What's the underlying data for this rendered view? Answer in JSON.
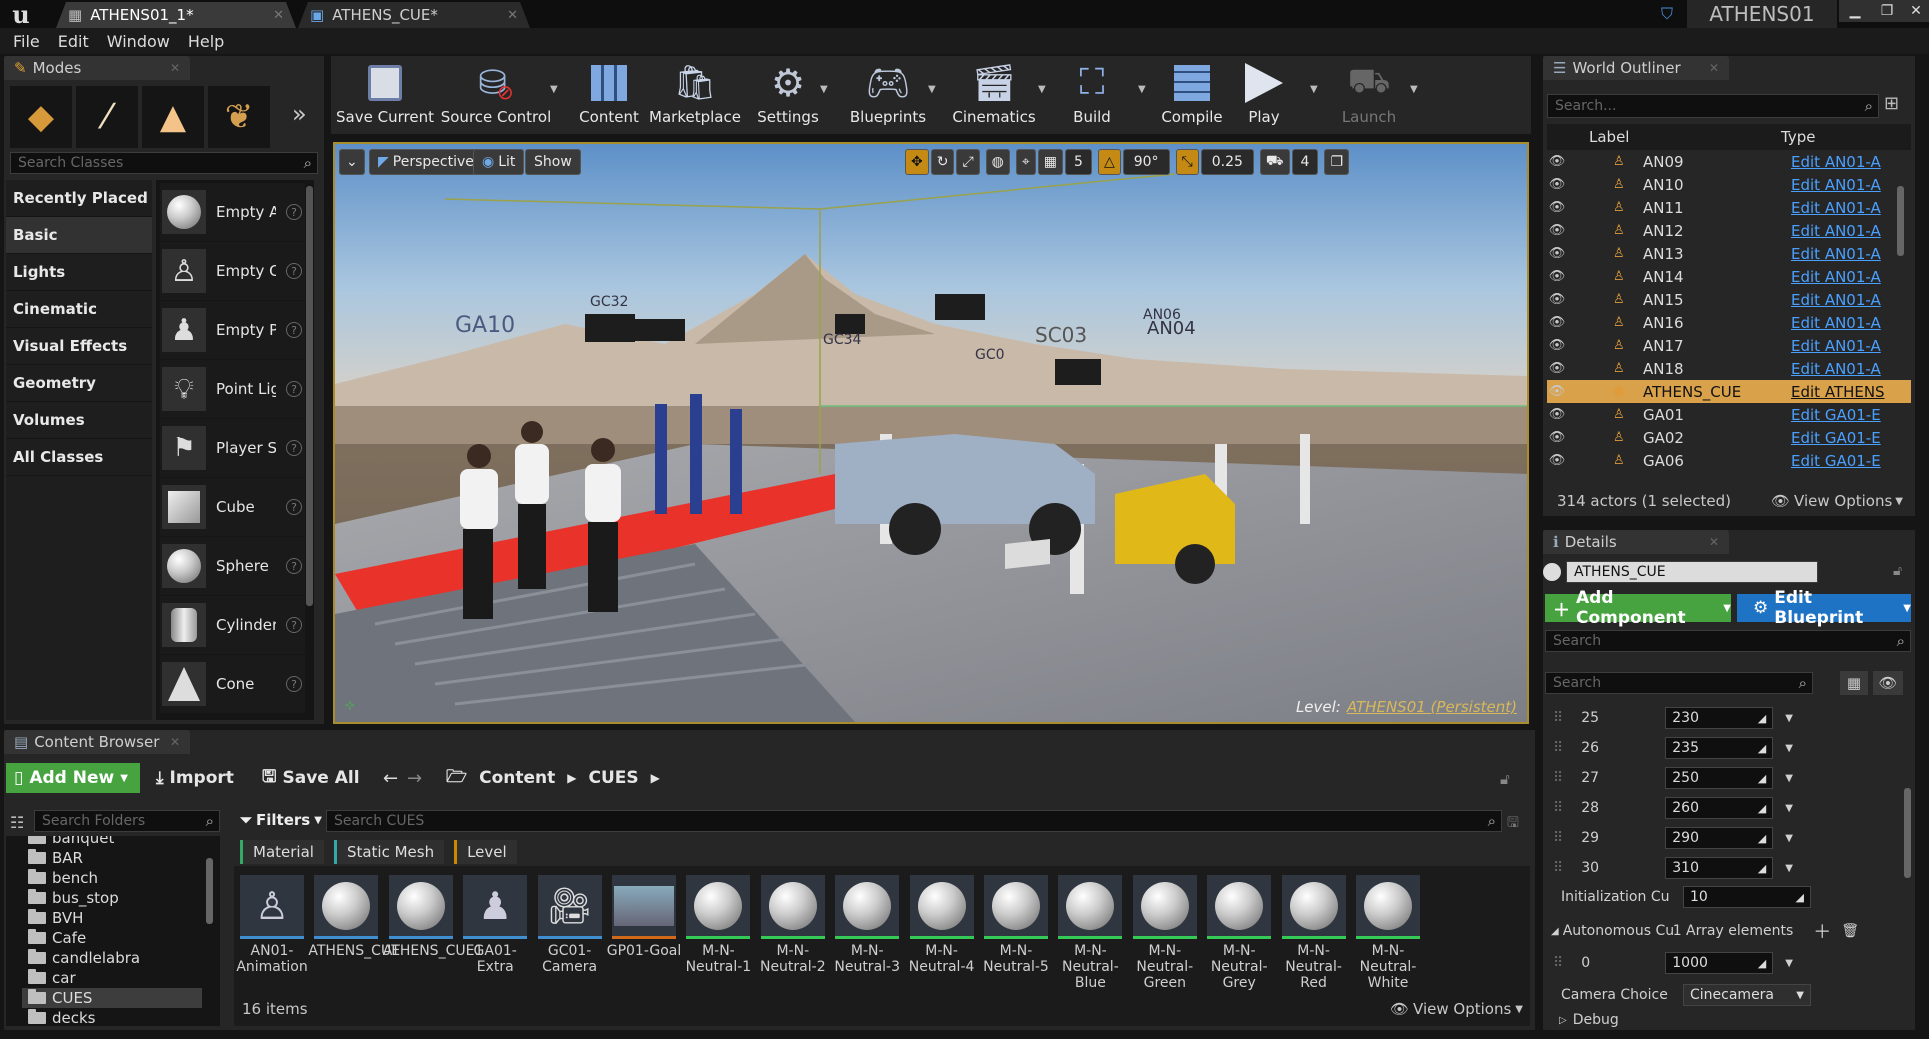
{
  "titlebar": {
    "tabs": [
      {
        "label": "ATHENS01_1*"
      },
      {
        "label": "ATHENS_CUE*"
      }
    ],
    "project": "ATHENS01"
  },
  "menu": [
    "File",
    "Edit",
    "Window",
    "Help"
  ],
  "modes": {
    "tab": "Modes",
    "search_placeholder": "Search Classes",
    "categories": [
      "Recently Placed",
      "Basic",
      "Lights",
      "Cinematic",
      "Visual Effects",
      "Geometry",
      "Volumes",
      "All Classes"
    ],
    "items": [
      "Empty Actor",
      "Empty Character",
      "Empty Pawn",
      "Point Light",
      "Player Start",
      "Cube",
      "Sphere",
      "Cylinder",
      "Cone"
    ]
  },
  "toolbar": [
    "Save Current",
    "Source Control",
    "Content",
    "Marketplace",
    "Settings",
    "Blueprints",
    "Cinematics",
    "Build",
    "Compile",
    "Play",
    "Launch"
  ],
  "viewport": {
    "perspective": "Perspective",
    "lit": "Lit",
    "show": "Show",
    "grid": "5",
    "angle": "90°",
    "scale": "0.25",
    "cam_speed": "4",
    "level_label": "Level:",
    "level_name": "ATHENS01 (Persistent)",
    "scene_labels": [
      "GC32",
      "GA10",
      "GC34",
      "AN06",
      "AN04",
      "GC0",
      "SC03"
    ]
  },
  "outliner": {
    "tab": "World Outliner",
    "search_placeholder": "Search...",
    "col_label": "Label",
    "col_type": "Type",
    "rows": [
      {
        "label": "AN09",
        "type": "Edit AN01-A"
      },
      {
        "label": "AN10",
        "type": "Edit AN01-A"
      },
      {
        "label": "AN11",
        "type": "Edit AN01-A"
      },
      {
        "label": "AN12",
        "type": "Edit AN01-A"
      },
      {
        "label": "AN13",
        "type": "Edit AN01-A"
      },
      {
        "label": "AN14",
        "type": "Edit AN01-A"
      },
      {
        "label": "AN15",
        "type": "Edit AN01-A"
      },
      {
        "label": "AN16",
        "type": "Edit AN01-A"
      },
      {
        "label": "AN17",
        "type": "Edit AN01-A"
      },
      {
        "label": "AN18",
        "type": "Edit AN01-A"
      },
      {
        "label": "ATHENS_CUE",
        "type": "Edit ATHENS"
      },
      {
        "label": "GA01",
        "type": "Edit GA01-E"
      },
      {
        "label": "GA02",
        "type": "Edit GA01-E"
      },
      {
        "label": "GA06",
        "type": "Edit GA01-E"
      }
    ],
    "selected_row": "ATHENS_CUE",
    "count": "314 actors (1 selected)",
    "view_options": "View Options"
  },
  "details": {
    "tab": "Details",
    "name": "ATHENS_CUE",
    "add_component": "Add Component",
    "edit_blueprint": "Edit Blueprint",
    "search_placeholder": "Search",
    "array_rows": [
      {
        "index": "25",
        "value": "230"
      },
      {
        "index": "26",
        "value": "235"
      },
      {
        "index": "27",
        "value": "250"
      },
      {
        "index": "28",
        "value": "260"
      },
      {
        "index": "29",
        "value": "290"
      },
      {
        "index": "30",
        "value": "310"
      }
    ],
    "init_label": "Initialization Cu",
    "init_value": "10",
    "auto_label": "Autonomous Cu",
    "auto_value": "1 Array elements",
    "auto_index": "0",
    "auto_entry": "1000",
    "camera_label": "Camera Choice",
    "camera_value": "Cinecamera",
    "debug": "Debug"
  },
  "content_browser": {
    "tab": "Content Browser",
    "add_new": "Add New",
    "import": "Import",
    "save_all": "Save All",
    "path": [
      "Content",
      "CUES"
    ],
    "search_folders": "Search Folders",
    "filters": "Filters",
    "search_assets": "Search CUES",
    "filter_chips": [
      "Material",
      "Static Mesh",
      "Level"
    ],
    "folders": [
      "banquet",
      "BAR",
      "bench",
      "bus_stop",
      "BVH",
      "Cafe",
      "candlelabra",
      "car",
      "CUES",
      "decks"
    ],
    "selected_folder": "CUES",
    "assets": [
      {
        "label": "AN01-Animation"
      },
      {
        "label": "ATHENS_CUE"
      },
      {
        "label": "ATHENS_CUE1"
      },
      {
        "label": "GA01-Extra"
      },
      {
        "label": "GC01-Camera"
      },
      {
        "label": "GP01-Goal"
      },
      {
        "label": "M-N-Neutral-1"
      },
      {
        "label": "M-N-Neutral-2"
      },
      {
        "label": "M-N-Neutral-3"
      },
      {
        "label": "M-N-Neutral-4"
      },
      {
        "label": "M-N-Neutral-5"
      },
      {
        "label": "M-N-Neutral-Blue"
      },
      {
        "label": "M-N-Neutral-Green"
      },
      {
        "label": "M-N-Neutral-Grey"
      },
      {
        "label": "M-N-Neutral-Red"
      },
      {
        "label": "M-N-Neutral-White"
      }
    ],
    "count": "16 items",
    "view_options": "View Options"
  },
  "colors": {
    "accent": "#d8a14a",
    "link": "#4aa0ff",
    "green": "#46a33f",
    "blue": "#1e73c4"
  }
}
